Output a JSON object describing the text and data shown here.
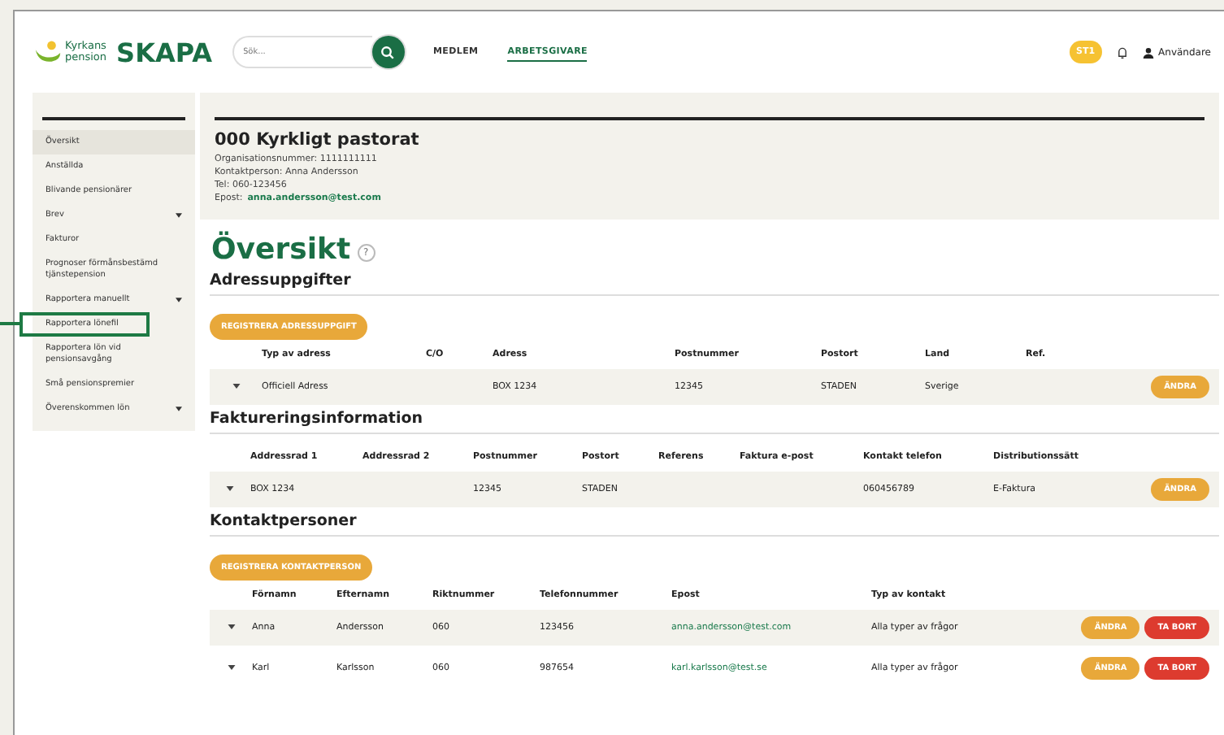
{
  "header": {
    "logo_line1": "Kyrkans",
    "logo_line2": "pension",
    "brand": "SKAPA",
    "search": {
      "placeholder": "Sök..."
    },
    "nav": [
      {
        "label": "MEDLEM",
        "selected": false
      },
      {
        "label": "ARBETSGIVARE",
        "selected": true
      }
    ],
    "badge": "ST1",
    "user": "Användare"
  },
  "sidebar": {
    "items": [
      {
        "label": "Översikt",
        "selected": true,
        "expandable": false,
        "highlighted": false
      },
      {
        "label": "Anställda",
        "selected": false,
        "expandable": false,
        "highlighted": false
      },
      {
        "label": "Blivande pensionärer",
        "selected": false,
        "expandable": false,
        "highlighted": false
      },
      {
        "label": "Brev",
        "selected": false,
        "expandable": true,
        "highlighted": false
      },
      {
        "label": "Fakturor",
        "selected": false,
        "expandable": false,
        "highlighted": false
      },
      {
        "label": "Prognoser förmånsbestämd tjänstepension",
        "selected": false,
        "expandable": false,
        "highlighted": false
      },
      {
        "label": "Rapportera manuellt",
        "selected": false,
        "expandable": true,
        "highlighted": false
      },
      {
        "label": "Rapportera lönefil",
        "selected": false,
        "expandable": false,
        "highlighted": true
      },
      {
        "label": "Rapportera lön vid pensionsavgång",
        "selected": false,
        "expandable": false,
        "highlighted": false
      },
      {
        "label": "Små pensionspremier",
        "selected": false,
        "expandable": false,
        "highlighted": false
      },
      {
        "label": "Överenskommen lön",
        "selected": false,
        "expandable": true,
        "highlighted": false
      }
    ]
  },
  "organization": {
    "title": "000 Kyrkligt pastorat",
    "lines": [
      "Organisationsnummer: 1111111111",
      "Kontaktperson: Anna Andersson",
      "Tel: 060-123456"
    ],
    "email_label": "Epost:",
    "email": "anna.andersson@test.com"
  },
  "page_title": "Översikt",
  "help": "?",
  "sections": [
    {
      "heading": "Adressuppgifter",
      "button": "REGISTRERA ADRESSUPPGIFT",
      "columns": [
        "Typ av adress",
        "C/O",
        "Adress",
        "Postnummer",
        "Postort",
        "Land",
        "Ref."
      ],
      "rows": [
        {
          "cells": [
            {
              "text": "Officiell Adress",
              "kind": "text"
            },
            {
              "text": "",
              "kind": "text"
            },
            {
              "text": "BOX 1234",
              "kind": "text"
            },
            {
              "text": "12345",
              "kind": "text"
            },
            {
              "text": "STADEN",
              "kind": "text"
            },
            {
              "text": "Sverige",
              "kind": "text"
            },
            {
              "text": "",
              "kind": "text"
            }
          ],
          "actions": [
            {
              "label": "ÄNDRA",
              "kind": "edit"
            }
          ]
        }
      ]
    },
    {
      "heading": "Faktureringsinformation",
      "columns": [
        "Addressrad 1",
        "Addressrad 2",
        "Postnummer",
        "Postort",
        "Referens",
        "Faktura e-post",
        "Kontakt telefon",
        "Distributionssätt"
      ],
      "rows": [
        {
          "cells": [
            {
              "text": "BOX 1234",
              "kind": "text"
            },
            {
              "text": "",
              "kind": "text"
            },
            {
              "text": "12345",
              "kind": "text"
            },
            {
              "text": "STADEN",
              "kind": "text"
            },
            {
              "text": "",
              "kind": "text"
            },
            {
              "text": "",
              "kind": "text"
            },
            {
              "text": "060456789",
              "kind": "text"
            },
            {
              "text": "E-Faktura",
              "kind": "text"
            }
          ],
          "actions": [
            {
              "label": "ÄNDRA",
              "kind": "edit"
            }
          ]
        }
      ]
    },
    {
      "heading": "Kontaktpersoner",
      "button": "REGISTRERA KONTAKTPERSON",
      "columns": [
        "Förnamn",
        "Efternamn",
        "Riktnummer",
        "Telefonnummer",
        "Epost",
        "Typ av kontakt"
      ],
      "rows": [
        {
          "cells": [
            {
              "text": "Anna",
              "kind": "text"
            },
            {
              "text": "Andersson",
              "kind": "text"
            },
            {
              "text": "060",
              "kind": "text"
            },
            {
              "text": "123456",
              "kind": "text"
            },
            {
              "text": "anna.andersson@test.com",
              "kind": "link"
            },
            {
              "text": "Alla typer av frågor",
              "kind": "text"
            }
          ],
          "actions": [
            {
              "label": "ÄNDRA",
              "kind": "edit"
            },
            {
              "label": "TA BORT",
              "kind": "delete"
            }
          ]
        },
        {
          "cells": [
            {
              "text": "Karl",
              "kind": "text"
            },
            {
              "text": "Karlsson",
              "kind": "text"
            },
            {
              "text": "060",
              "kind": "text"
            },
            {
              "text": "987654",
              "kind": "text"
            },
            {
              "text": "karl.karlsson@test.se",
              "kind": "link"
            },
            {
              "text": "Alla typer av frågor",
              "kind": "text"
            }
          ],
          "actions": [
            {
              "label": "ÄNDRA",
              "kind": "edit"
            },
            {
              "label": "TA BORT",
              "kind": "delete"
            }
          ]
        }
      ]
    }
  ]
}
